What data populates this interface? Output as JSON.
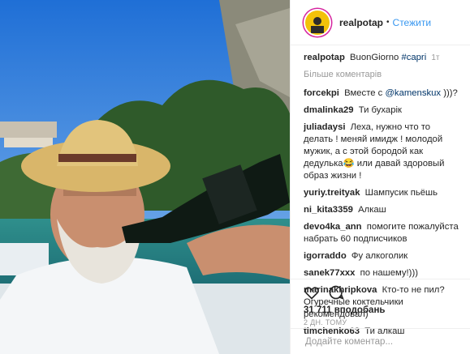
{
  "post": {
    "username": "realpotap",
    "follow_label": "Стежити",
    "dot": "•",
    "caption_user": "realpotap",
    "caption_text": "BuonGiorno",
    "caption_tag": "#capri",
    "caption_time": "1т",
    "more_comments": "Більше коментарів",
    "likes": "31 711 вподобань",
    "time_ago": "2 дн. тому",
    "add_comment_placeholder": "Додайте коментар..."
  },
  "comments": [
    {
      "user": "forcekpi",
      "text": "Вместе с",
      "mention": "@kamenskux",
      "after": ")))?"
    },
    {
      "user": "dmalinka29",
      "text": "Ти бухарік"
    },
    {
      "user": "juliadaysi",
      "text": "Леха, нужно что то делать ! меняй имидж ! молодой мужик, а с этой бородой как дедулька😂 или давай здоровый образ жизни !"
    },
    {
      "user": "yuriy.treityak",
      "text": "Шампусик пьёшь"
    },
    {
      "user": "ni_kita3359",
      "text": "Алкаш"
    },
    {
      "user": "devo4ka_ann",
      "text": "помогите пожалуйста набрать 60 подписчиков"
    },
    {
      "user": "igorraddo",
      "text": "Фу алкоголик"
    },
    {
      "user": "sanek77xxx",
      "text": "по нашему!)))"
    },
    {
      "user": "marinakhripkova",
      "text": "Кто-то не пил? Огуречные коктельчики рекомендовал)"
    },
    {
      "user": "timchenko63",
      "text": "Ти алкаш"
    }
  ],
  "colors": {
    "accent": "#3897f0",
    "mention": "#003569",
    "muted": "#999999"
  }
}
